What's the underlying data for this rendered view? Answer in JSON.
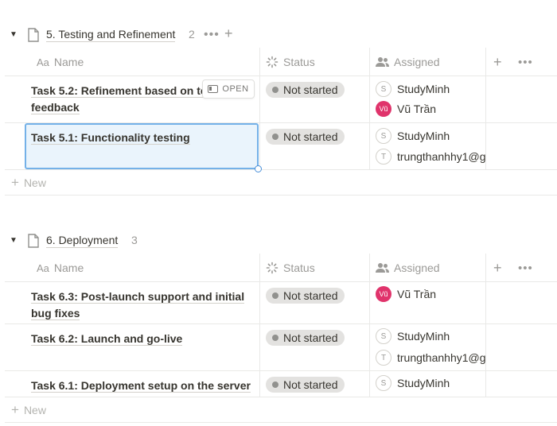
{
  "groups": [
    {
      "title": "5. Testing and Refinement",
      "count": "2",
      "columns": {
        "name": "Name",
        "status": "Status",
        "assigned": "Assigned",
        "name_icon": "Aa"
      },
      "rows": [
        {
          "name": "Task 5.2: Refinement based on testing",
          "name_line2": "feedback",
          "status": "Not started",
          "people": [
            {
              "initial": "S",
              "name": "StudyMinh",
              "avatar": "letter"
            },
            {
              "initial": "Vũ",
              "name": "Vũ Trần",
              "avatar": "photo"
            }
          ]
        },
        {
          "name": "Task 5.1: Functionality testing",
          "name_line2": "",
          "status": "Not started",
          "people": [
            {
              "initial": "S",
              "name": "StudyMinh",
              "avatar": "letter"
            },
            {
              "initial": "T",
              "name": "trungthanhhy1@g",
              "avatar": "letter"
            }
          ]
        }
      ],
      "new_label": "New"
    },
    {
      "title": "6. Deployment",
      "count": "3",
      "columns": {
        "name": "Name",
        "status": "Status",
        "assigned": "Assigned",
        "name_icon": "Aa"
      },
      "rows": [
        {
          "name": "Task 6.3: Post-launch support and initial",
          "name_line2": "bug fixes",
          "status": "Not started",
          "people": [
            {
              "initial": "Vũ",
              "name": "Vũ Trần",
              "avatar": "photo"
            }
          ]
        },
        {
          "name": "Task 6.2: Launch and go-live",
          "name_line2": "",
          "status": "Not started",
          "people": [
            {
              "initial": "S",
              "name": "StudyMinh",
              "avatar": "letter"
            },
            {
              "initial": "T",
              "name": "trungthanhhy1@g",
              "avatar": "letter"
            }
          ]
        },
        {
          "name": "Task 6.1: Deployment setup on the server",
          "name_line2": "",
          "status": "Not started",
          "people": [
            {
              "initial": "S",
              "name": "StudyMinh",
              "avatar": "letter"
            }
          ]
        }
      ],
      "new_label": "New"
    }
  ],
  "open_button": {
    "label": "OPEN",
    "icon": "side-peek-icon"
  },
  "colors": {
    "text": "#37352f",
    "muted": "#9b9a97",
    "pill": "#e3e2e0",
    "selection": "#74b1e8",
    "avatar_photo": "#e0336b"
  }
}
